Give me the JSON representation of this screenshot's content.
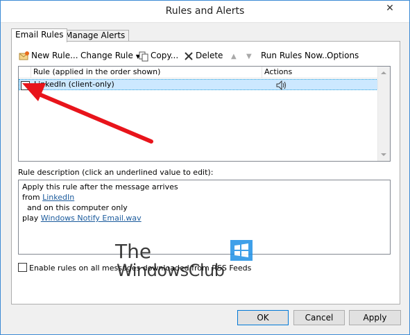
{
  "window": {
    "title": "Rules and Alerts",
    "close_glyph": "✕"
  },
  "tabs": [
    {
      "label": "Email Rules",
      "active": true
    },
    {
      "label": "Manage Alerts",
      "active": false
    }
  ],
  "toolbar": {
    "new_rule": "New Rule...",
    "change_rule": "Change Rule",
    "copy": "Copy...",
    "delete": "Delete",
    "run_rules_now": "Run Rules Now...",
    "options": "Options"
  },
  "rules_list": {
    "columns": [
      "Rule (applied in the order shown)",
      "Actions"
    ],
    "rows": [
      {
        "name": "LinkedIn  (client-only)",
        "checked": false,
        "action_icon": "speaker-icon"
      }
    ]
  },
  "description": {
    "label": "Rule description (click an underlined value to edit):",
    "line1": "Apply this rule after the message arrives",
    "line2_prefix": "from ",
    "line2_link": "LinkedIn",
    "line3": "  and on this computer only",
    "line4_prefix": "play ",
    "line4_link": "Windows Notify Email.wav"
  },
  "rss_option": {
    "label": "Enable rules on all messages downloaded from RSS Feeds",
    "checked": false
  },
  "buttons": {
    "ok": "OK",
    "cancel": "Cancel",
    "apply": "Apply"
  },
  "watermark": {
    "line1": "The",
    "line2": "WindowsClub"
  },
  "colors": {
    "accent": "#0078d7",
    "selection": "#cce8ff",
    "arrow": "#e8141b",
    "link": "#1a5a9c"
  }
}
